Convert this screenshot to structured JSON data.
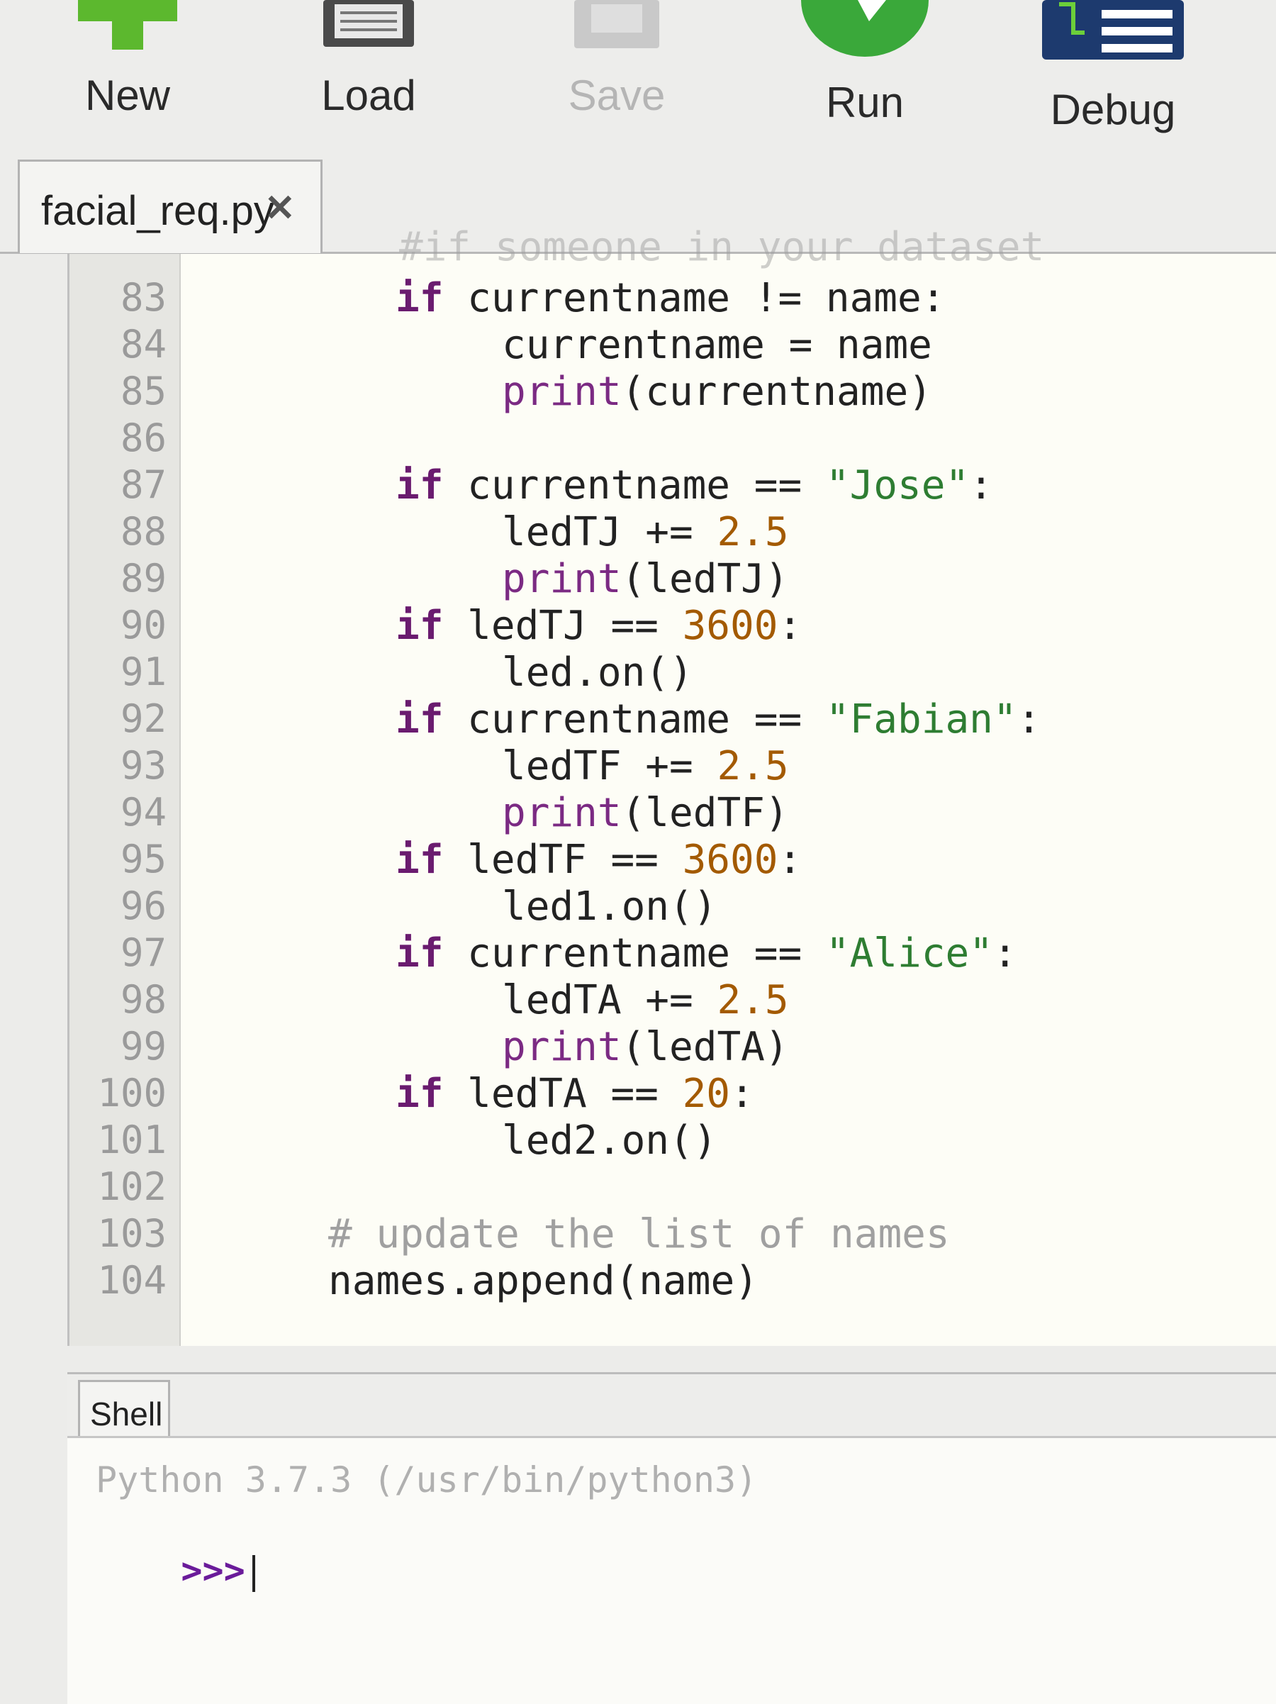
{
  "toolbar": {
    "items": [
      {
        "label": "New",
        "icon": "new-plus-icon",
        "enabled": true
      },
      {
        "label": "Load",
        "icon": "load-folder-icon",
        "enabled": true
      },
      {
        "label": "Save",
        "icon": "save-disk-icon",
        "enabled": false
      },
      {
        "label": "Run",
        "icon": "run-play-icon",
        "enabled": true
      },
      {
        "label": "Debug",
        "icon": "debug-icon",
        "enabled": true
      }
    ]
  },
  "colors": {
    "new_icon": "#5cb82e",
    "run_icon": "#3aa83a",
    "debug_icon": "#1d3a6e",
    "keyword": "#6a1b6f",
    "string": "#2e7d32",
    "number": "#a35a00",
    "comment": "#a0a0a0"
  },
  "editor": {
    "tab": {
      "filename": "facial_req.py",
      "close": "✕"
    },
    "top_partial_comment": "#if someone in your dataset",
    "lines": [
      {
        "no": "83",
        "code": "if currentname != name:"
      },
      {
        "no": "84",
        "code": "    currentname = name"
      },
      {
        "no": "85",
        "code": "    print(currentname)"
      },
      {
        "no": "86",
        "code": ""
      },
      {
        "no": "87",
        "code": "if currentname == \"Jose\":"
      },
      {
        "no": "88",
        "code": "    ledTJ += 2.5"
      },
      {
        "no": "89",
        "code": "    print(ledTJ)"
      },
      {
        "no": "90",
        "code": "if ledTJ == 3600:"
      },
      {
        "no": "91",
        "code": "    led.on()"
      },
      {
        "no": "92",
        "code": "if currentname == \"Fabian\":"
      },
      {
        "no": "93",
        "code": "    ledTF += 2.5"
      },
      {
        "no": "94",
        "code": "    print(ledTF)"
      },
      {
        "no": "95",
        "code": "if ledTF == 3600:"
      },
      {
        "no": "96",
        "code": "    led1.on()"
      },
      {
        "no": "97",
        "code": "if currentname == \"Alice\":"
      },
      {
        "no": "98",
        "code": "    ledTA += 2.5"
      },
      {
        "no": "99",
        "code": "    print(ledTA)"
      },
      {
        "no": "100",
        "code": "if ledTA == 20:"
      },
      {
        "no": "101",
        "code": "    led2.on()"
      },
      {
        "no": "102",
        "code": ""
      },
      {
        "no": "103",
        "code": "# update the list of names"
      },
      {
        "no": "104",
        "code": "names.append(name)"
      }
    ]
  },
  "shell": {
    "tab_label": "Shell",
    "banner": "Python 3.7.3 (/usr/bin/python3)",
    "prompt": ">>>"
  }
}
